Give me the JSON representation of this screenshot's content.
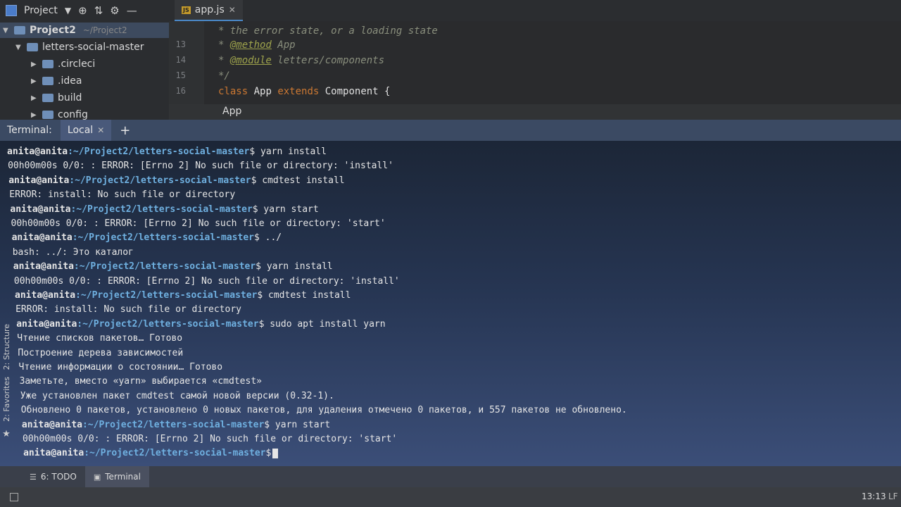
{
  "toolbar": {
    "project_label": "Project",
    "file_tab": "app.js",
    "file_tab_icon": "js-file-icon"
  },
  "project_tree": {
    "items": [
      {
        "label": "Project2",
        "detail": "~/Project2",
        "expanded": true
      },
      {
        "label": "letters-social-master",
        "expanded": true
      },
      {
        "label": ".circleci",
        "expanded": false
      },
      {
        "label": ".idea",
        "expanded": false
      },
      {
        "label": "build",
        "expanded": false
      },
      {
        "label": "config",
        "expanded": false
      }
    ]
  },
  "editor": {
    "lines": [
      {
        "num": "",
        "text": "* the error state, or a loading state"
      },
      {
        "num": "13",
        "prefix": "* ",
        "tag": "@method",
        "rest": " App"
      },
      {
        "num": "14",
        "prefix": "* ",
        "tag": "@module",
        "rest": " letters/components"
      },
      {
        "num": "15",
        "text": "*/"
      },
      {
        "num": "16",
        "kw1": "class",
        "name": " App ",
        "kw2": "extends",
        "rest": " Component {"
      }
    ],
    "breadcrumb": "App"
  },
  "terminal": {
    "label": "Terminal:",
    "tab": "Local",
    "user": "anita@anita",
    "path": ":~/Project2/letters-social-master",
    "lines": [
      {
        "type": "prompt",
        "cmd": "$ yarn install"
      },
      {
        "type": "out",
        "text": "00h00m00s 0/0: : ERROR: [Errno 2] No such file or directory: 'install'"
      },
      {
        "type": "prompt",
        "cmd": "$ cmdtest install"
      },
      {
        "type": "out",
        "text": "ERROR: install: No such file or directory"
      },
      {
        "type": "prompt",
        "cmd": "$ yarn start"
      },
      {
        "type": "out",
        "text": "00h00m00s 0/0: : ERROR: [Errno 2] No such file or directory: 'start'"
      },
      {
        "type": "prompt",
        "cmd": "$ ../"
      },
      {
        "type": "out",
        "text": "bash: ../: Это каталог"
      },
      {
        "type": "prompt",
        "cmd": "$ yarn install"
      },
      {
        "type": "out",
        "text": "00h00m00s 0/0: : ERROR: [Errno 2] No such file or directory: 'install'"
      },
      {
        "type": "prompt",
        "cmd": "$ cmdtest install"
      },
      {
        "type": "out",
        "text": "ERROR: install: No such file or directory"
      },
      {
        "type": "prompt",
        "cmd": "$ sudo apt install yarn"
      },
      {
        "type": "out",
        "text": "Чтение списков пакетов… Готово"
      },
      {
        "type": "out",
        "text": "Построение дерева зависимостей"
      },
      {
        "type": "out",
        "text": "Чтение информации о состоянии… Готово"
      },
      {
        "type": "out",
        "text": "Заметьте, вместо «yarn» выбирается «cmdtest»"
      },
      {
        "type": "out",
        "text": "Уже установлен пакет cmdtest самой новой версии (0.32-1)."
      },
      {
        "type": "out",
        "text": "Обновлено 0 пакетов, установлено 0 новых пакетов, для удаления отмечено 0 пакетов, и 557 пакетов не обновлено."
      },
      {
        "type": "prompt",
        "cmd": "$ yarn start"
      },
      {
        "type": "out",
        "text": "00h00m00s 0/0: : ERROR: [Errno 2] No such file or directory: 'start'"
      },
      {
        "type": "prompt",
        "cmd": "$"
      }
    ]
  },
  "side_tabs": {
    "structure": "2: Structure",
    "favorites": "2: Favorites"
  },
  "bottom_tabs": {
    "todo": "6: TODO",
    "terminal": "Terminal"
  },
  "status_bar": {
    "time": "13:13",
    "line_sep": "LF"
  },
  "colors": {
    "accent": "#4a88c7",
    "prompt_path": "#6fb0e0"
  }
}
